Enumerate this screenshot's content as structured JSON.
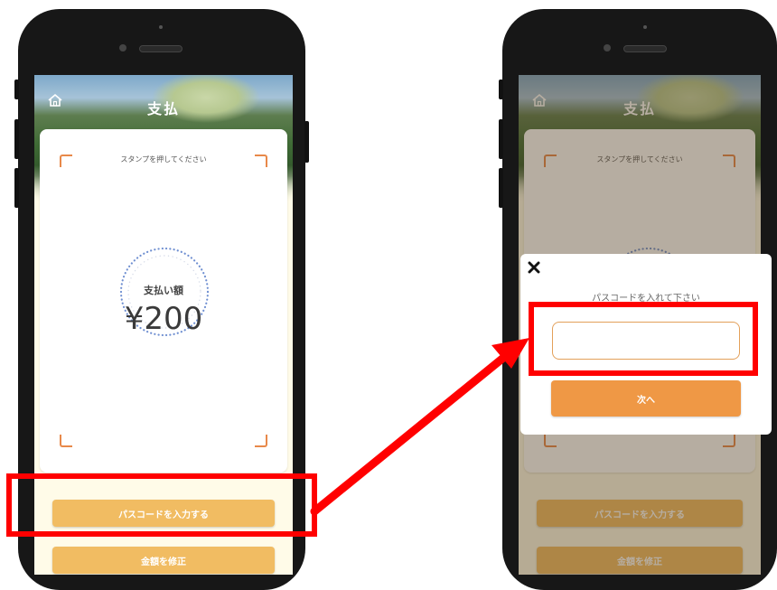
{
  "left_phone": {
    "header_title": "支払",
    "home_icon": "home-icon",
    "stamp_hint": "スタンプを押してください",
    "amount_label": "支払い額",
    "amount": "¥200",
    "buttons": {
      "enter_passcode": "パスコードを入力する",
      "edit_amount": "金額を修正"
    }
  },
  "right_phone": {
    "header_title": "支払",
    "stamp_hint": "スタンプを押してください",
    "buttons": {
      "enter_passcode": "パスコードを入力する",
      "edit_amount": "金額を修正"
    },
    "modal": {
      "close_icon": "close-icon",
      "prompt": "パスコードを入れて下さい",
      "passcode_value": "",
      "next_button": "次へ"
    }
  },
  "colors": {
    "highlight": "#ff0000",
    "button_yellow": "#f1bc62",
    "button_orange": "#ef9845",
    "corner_orange": "#e8894a",
    "phone_body": "#171717"
  }
}
